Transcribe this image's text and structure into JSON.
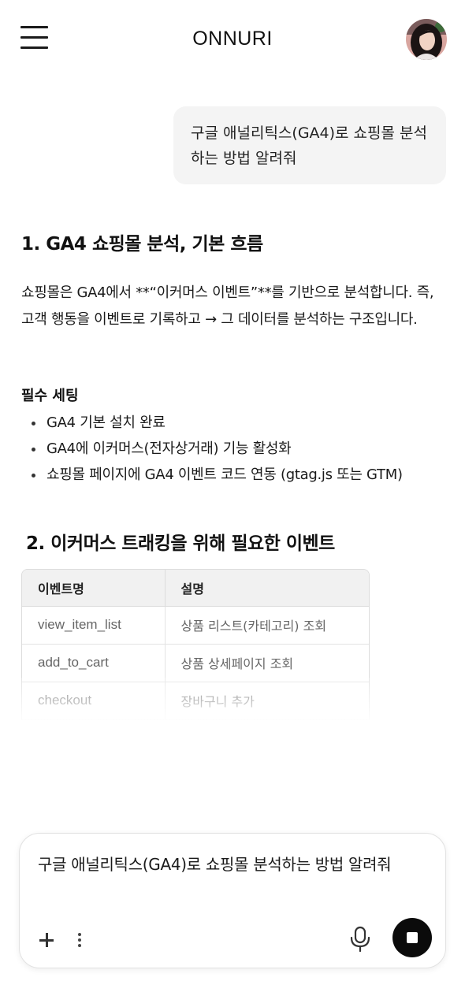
{
  "header": {
    "title": "ONNURI"
  },
  "conversation": {
    "user_message": "구글 애널리틱스(GA4)로 쇼핑몰 분석하는 방법 알려줘",
    "section1": {
      "heading": "1. GA4 쇼핑몰 분석, 기본 흐름",
      "paragraph": "쇼핑몰은 GA4에서 **“이커머스 이벤트”**를 기반으로 분석합니다. 즉, 고객 행동을 이벤트로 기록하고 → 그 데이터를 분석하는 구조입니다.",
      "subheading": "필수 세팅",
      "bullets": [
        "GA4 기본 설치 완료",
        "GA4에 이커머스(전자상거래) 기능 활성화",
        "쇼핑몰 페이지에 GA4 이벤트 코드 연동 (gtag.js 또는 GTM)"
      ]
    },
    "section2": {
      "heading": "2. 이커머스 트래킹을 위해 필요한 이벤트",
      "table": {
        "headers": [
          "이벤트명",
          "설명"
        ],
        "rows": [
          [
            "view_item_list",
            "상품 리스트(카테고리) 조회"
          ],
          [
            "add_to_cart",
            "상품 상세페이지 조회"
          ],
          [
            "checkout",
            "장바구니 추가"
          ]
        ]
      }
    }
  },
  "composer": {
    "text": "구글 애널리틱스(GA4)로 쇼핑몰 분석하는 방법 알려줘"
  },
  "icons": {
    "menu": "hamburger-menu-icon",
    "avatar": "user-avatar",
    "add": "plus-icon",
    "more": "more-vertical-icon",
    "mic": "microphone-icon",
    "stop": "stop-icon"
  },
  "colors": {
    "bubble_bg": "#f4f4f4",
    "table_header_bg": "#f1f1f1",
    "stop_button": "#0b0b0b"
  }
}
